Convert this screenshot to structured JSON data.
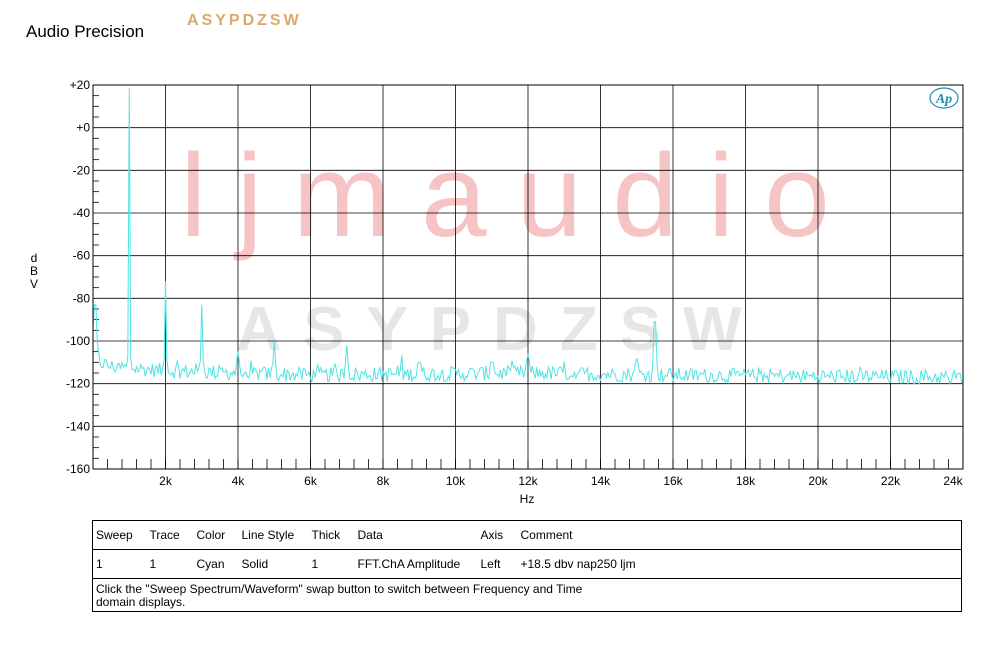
{
  "header": {
    "app_title": "Audio Precision",
    "brand": "ASYPDZSW"
  },
  "watermarks": {
    "large": "ljmaudio",
    "middle": "ASYPDZSW",
    "logo": "Ap"
  },
  "colors": {
    "trace": "#4fe3e3",
    "grid": "#000000",
    "watermark_red": "#f6c4c4",
    "watermark_gray": "#e6e6e6",
    "brand": "#d9aa6a",
    "logo": "#1a8fb0"
  },
  "chart_data": {
    "type": "line",
    "xlabel": "Hz",
    "ylabel": "dBV",
    "xlim": [
      0,
      24000
    ],
    "ylim": [
      -160,
      20
    ],
    "x_ticks": [
      2000,
      4000,
      6000,
      8000,
      10000,
      12000,
      14000,
      16000,
      18000,
      20000,
      22000,
      24000
    ],
    "x_tick_labels": [
      "2k",
      "4k",
      "6k",
      "8k",
      "10k",
      "12k",
      "14k",
      "16k",
      "18k",
      "20k",
      "22k",
      "24k"
    ],
    "y_ticks": [
      20,
      0,
      -20,
      -40,
      -60,
      -80,
      -100,
      -120,
      -140,
      -160
    ],
    "y_tick_labels": [
      "+20",
      "+0",
      "-20",
      "-40",
      "-60",
      "-80",
      "-100",
      "-120",
      "-140",
      "-160"
    ],
    "grid": true,
    "series": [
      {
        "noise_floor": [
          [
            0,
            -99
          ],
          [
            200,
            -110
          ],
          [
            500,
            -112
          ],
          [
            2000,
            -114
          ],
          [
            6000,
            -116
          ],
          [
            12000,
            -115
          ],
          [
            16000,
            -116
          ],
          [
            24000,
            -117
          ]
        ],
        "peaks": [
          [
            50,
            -83
          ],
          [
            1000,
            18.5
          ],
          [
            2000,
            -72
          ],
          [
            3000,
            -83
          ],
          [
            4000,
            -105
          ],
          [
            5000,
            -100
          ],
          [
            7000,
            -102
          ],
          [
            9000,
            -110
          ],
          [
            11000,
            -110
          ],
          [
            12000,
            -106
          ],
          [
            15000,
            -108
          ],
          [
            15500,
            -91
          ]
        ]
      }
    ]
  },
  "legend_table": {
    "columns": [
      "Sweep",
      "Trace",
      "Color",
      "Line Style",
      "Thick",
      "Data",
      "Axis",
      "Comment"
    ],
    "rows": [
      [
        "1",
        "1",
        "Cyan",
        "Solid",
        "1",
        "FFT.ChA Amplitude",
        "Left",
        "+18.5 dbv  nap250 ljm"
      ]
    ],
    "note_line1": "Click the \"Sweep Spectrum/Waveform\" swap button to switch between Frequency and Time",
    "note_line2": "domain displays."
  }
}
